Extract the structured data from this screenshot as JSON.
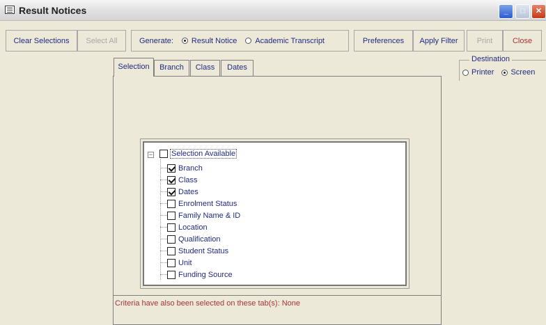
{
  "window": {
    "title": "Result Notices",
    "icon": "form-icon",
    "controls": [
      "minimize-icon",
      "maximize-icon",
      "close-icon"
    ]
  },
  "toolbar": {
    "clear_selections": "Clear Selections",
    "select_all": "Select All",
    "generate_label": "Generate:",
    "generate_options": [
      {
        "label": "Result Notice",
        "selected": true
      },
      {
        "label": "Academic Transcript",
        "selected": false
      }
    ],
    "preferences": "Preferences",
    "apply_filter": "Apply Filter",
    "print": "Print",
    "close": "Close"
  },
  "destination": {
    "title": "Destination",
    "options": [
      {
        "label": "Printer",
        "selected": false
      },
      {
        "label": "Screen",
        "selected": true
      }
    ]
  },
  "tabs": [
    {
      "label": "Selection",
      "active": true
    },
    {
      "label": "Branch",
      "active": false
    },
    {
      "label": "Class",
      "active": false
    },
    {
      "label": "Dates",
      "active": false
    }
  ],
  "tree": {
    "root": {
      "label": "Selection Available",
      "checked": false,
      "expanded": true
    },
    "items": [
      {
        "label": "Branch",
        "checked": true
      },
      {
        "label": "Class",
        "checked": true
      },
      {
        "label": "Dates",
        "checked": true
      },
      {
        "label": "Enrolment Status",
        "checked": false
      },
      {
        "label": "Family Name & ID",
        "checked": false
      },
      {
        "label": "Location",
        "checked": false
      },
      {
        "label": "Qualification",
        "checked": false
      },
      {
        "label": "Student Status",
        "checked": false
      },
      {
        "label": "Unit",
        "checked": false
      },
      {
        "label": "Funding Source",
        "checked": false
      }
    ]
  },
  "footer": {
    "criteria_text": "Criteria have also been selected on these tab(s): None"
  },
  "colors": {
    "background": "#ece9d8",
    "label_text": "#222a80",
    "accent_red": "#a8323a",
    "disabled_text": "#a8a8a8"
  }
}
